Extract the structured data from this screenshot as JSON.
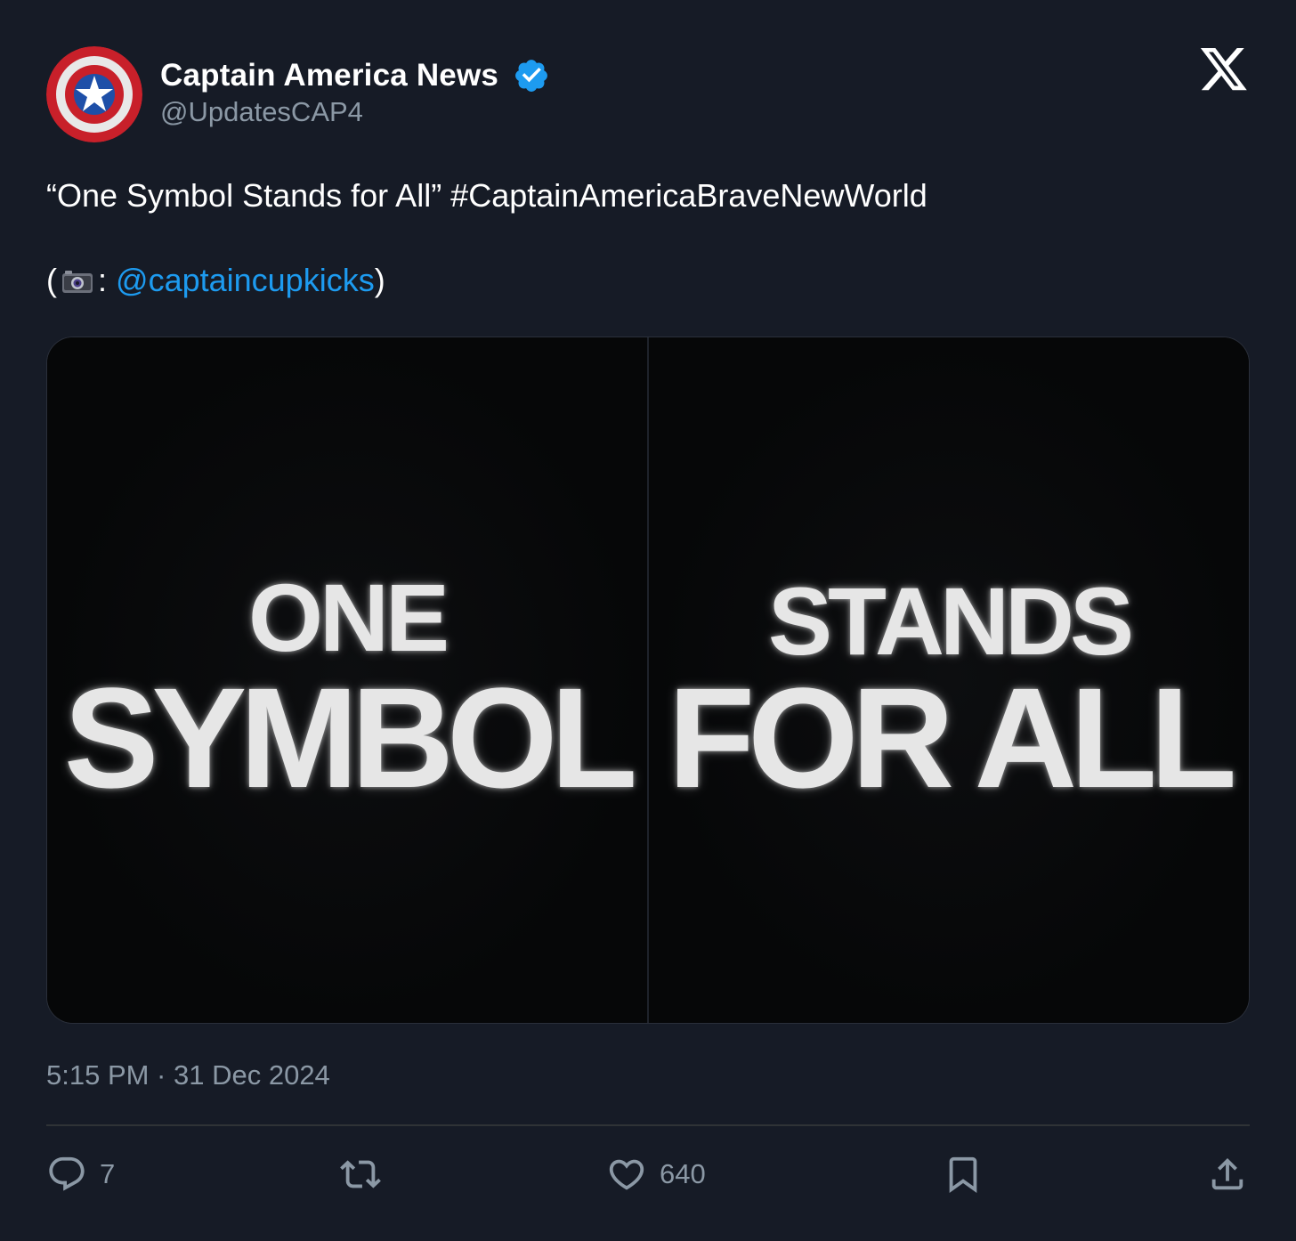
{
  "author": {
    "name": "Captain America News",
    "handle": "@UpdatesCAP4",
    "verified": true
  },
  "post": {
    "text_main": "“One Symbol Stands for All” #CaptainAmericaBraveNewWorld",
    "credit_open": "(",
    "credit_sep": ":",
    "credit_mention": "@captaincupkicks",
    "credit_close": ")",
    "timestamp": "5:15 PM · 31 Dec 2024"
  },
  "media": {
    "panel_left": {
      "line1": "ONE",
      "line2": "SYMBOL"
    },
    "panel_right": {
      "line1": "STANDS",
      "line2": "FOR ALL"
    }
  },
  "actions": {
    "reply_count": "7",
    "retweet_count": "",
    "like_count": "640"
  },
  "icons": [
    "captain-america-shield-avatar",
    "verified-badge-icon",
    "x-logo-icon",
    "camera-icon",
    "reply-icon",
    "retweet-icon",
    "like-icon",
    "bookmark-icon",
    "share-icon"
  ],
  "colors": {
    "background": "#161b26",
    "link": "#1d9bf0",
    "muted": "#8b98a5",
    "verified": "#1d9bf0"
  }
}
